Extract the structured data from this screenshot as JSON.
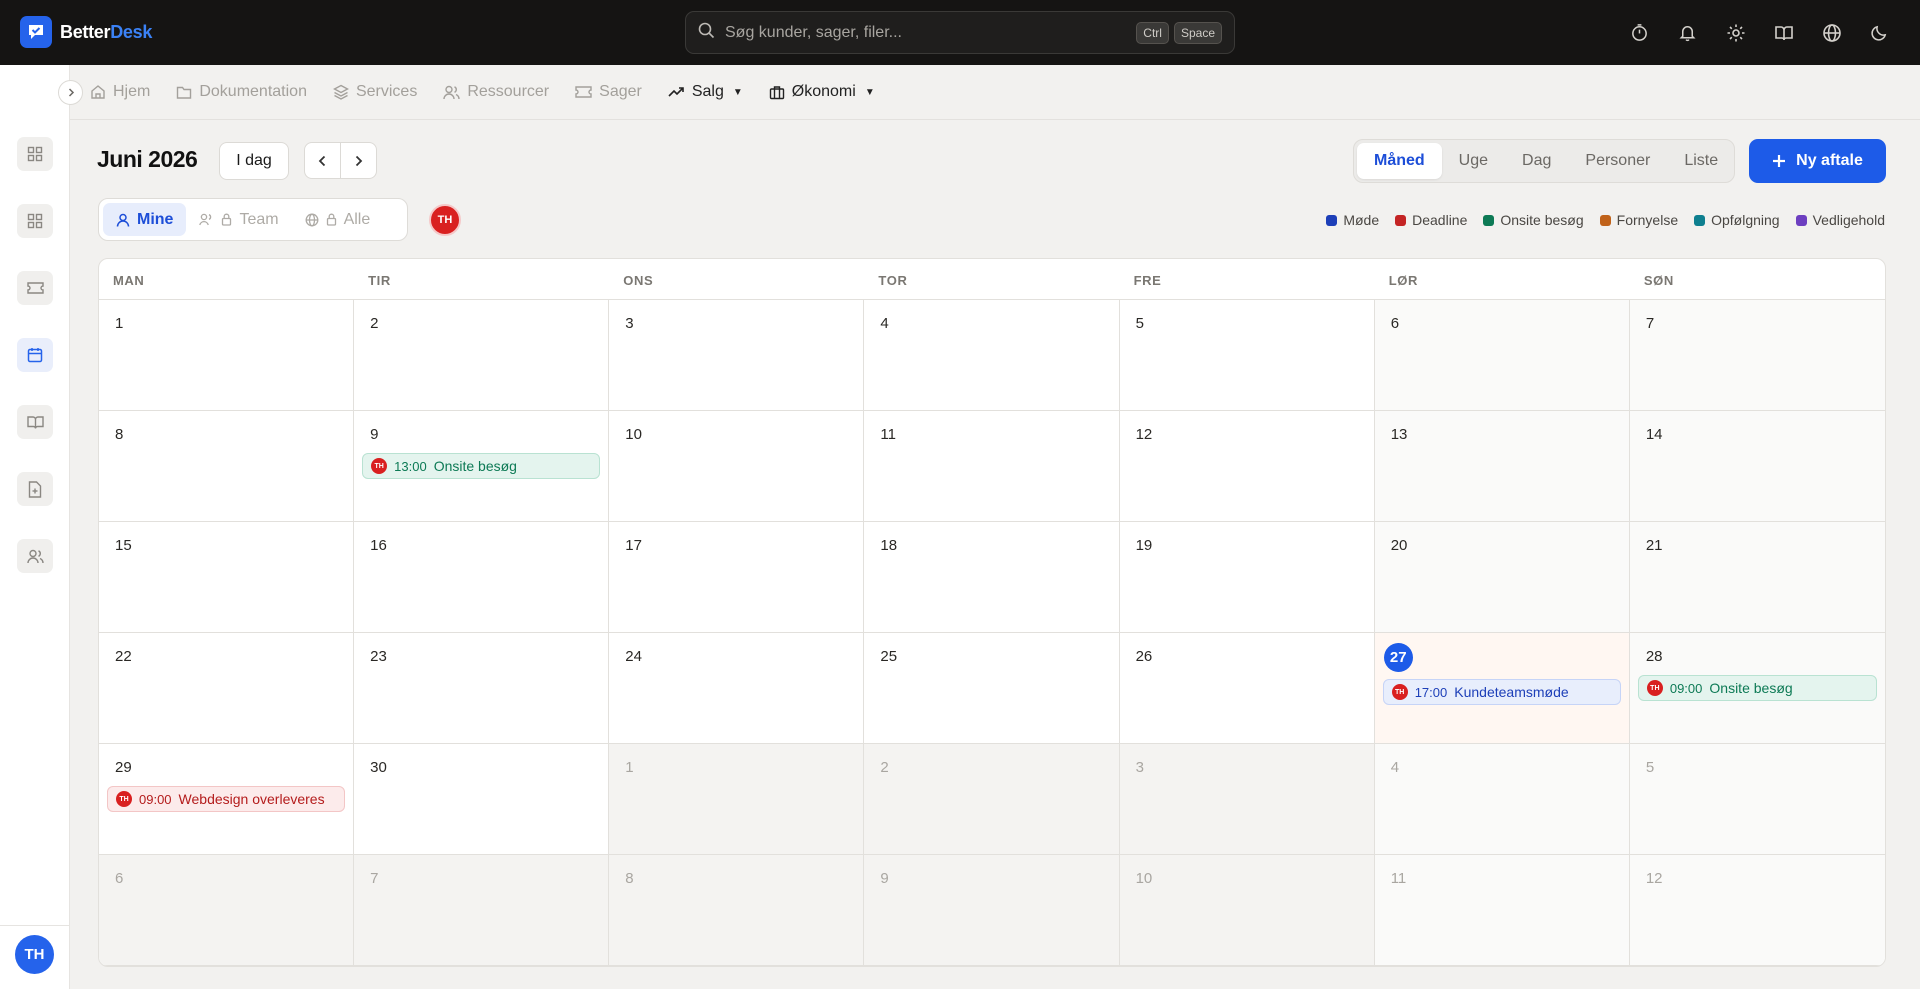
{
  "app": {
    "name_part1": "Better",
    "name_part2": "Desk"
  },
  "search": {
    "placeholder": "Søg kunder, sager, filer...",
    "kbd1": "Ctrl",
    "kbd2": "Space"
  },
  "top_icons": [
    "timer-icon",
    "bell-icon",
    "gear-icon",
    "book-icon",
    "globe-icon",
    "moon-icon"
  ],
  "nav": {
    "items": [
      {
        "label": "Hjem",
        "icon": "home-icon"
      },
      {
        "label": "Dokumentation",
        "icon": "folder-icon"
      },
      {
        "label": "Services",
        "icon": "layers-icon"
      },
      {
        "label": "Ressourcer",
        "icon": "users-icon"
      },
      {
        "label": "Sager",
        "icon": "ticket-icon"
      },
      {
        "label": "Salg",
        "icon": "trend-icon"
      },
      {
        "label": "Økonomi",
        "icon": "briefcase-icon"
      }
    ]
  },
  "sidebar": {
    "avatar": "TH"
  },
  "toolbar": {
    "month": "Juni 2026",
    "today": "I dag",
    "views": [
      "Måned",
      "Uge",
      "Dag",
      "Personer",
      "Liste"
    ],
    "active_view": "Måned",
    "new_button": "Ny aftale"
  },
  "filters": {
    "mine": "Mine",
    "team": "Team",
    "alle": "Alle",
    "user_chip": "TH"
  },
  "legend": [
    {
      "label": "Møde",
      "color": "#1d3fb8"
    },
    {
      "label": "Deadline",
      "color": "#c42424"
    },
    {
      "label": "Onsite besøg",
      "color": "#0d7a55"
    },
    {
      "label": "Fornyelse",
      "color": "#c0621a"
    },
    {
      "label": "Opfølgning",
      "color": "#0e7f8f"
    },
    {
      "label": "Vedligehold",
      "color": "#6d3fc0"
    }
  ],
  "calendar": {
    "weekdays": [
      "MAN",
      "TIR",
      "ONS",
      "TOR",
      "FRE",
      "LØR",
      "SØN"
    ],
    "days": [
      "1",
      "2",
      "3",
      "4",
      "5",
      "6",
      "7",
      "8",
      "9",
      "10",
      "11",
      "12",
      "13",
      "14",
      "15",
      "16",
      "17",
      "18",
      "19",
      "20",
      "21",
      "22",
      "23",
      "24",
      "25",
      "26",
      "27",
      "28",
      "29",
      "30",
      "1",
      "2",
      "3",
      "4",
      "5",
      "6",
      "7",
      "8",
      "9",
      "10",
      "11",
      "12"
    ],
    "events": {
      "ev_9": {
        "avatar": "TH",
        "time": "13:00",
        "title": "Onsite besøg"
      },
      "ev_27": {
        "avatar": "TH",
        "time": "17:00",
        "title": "Kundeteamsmøde"
      },
      "ev_28": {
        "avatar": "TH",
        "time": "09:00",
        "title": "Onsite besøg"
      },
      "ev_29": {
        "avatar": "TH",
        "time": "09:00",
        "title": "Webdesign overleveres"
      }
    }
  }
}
